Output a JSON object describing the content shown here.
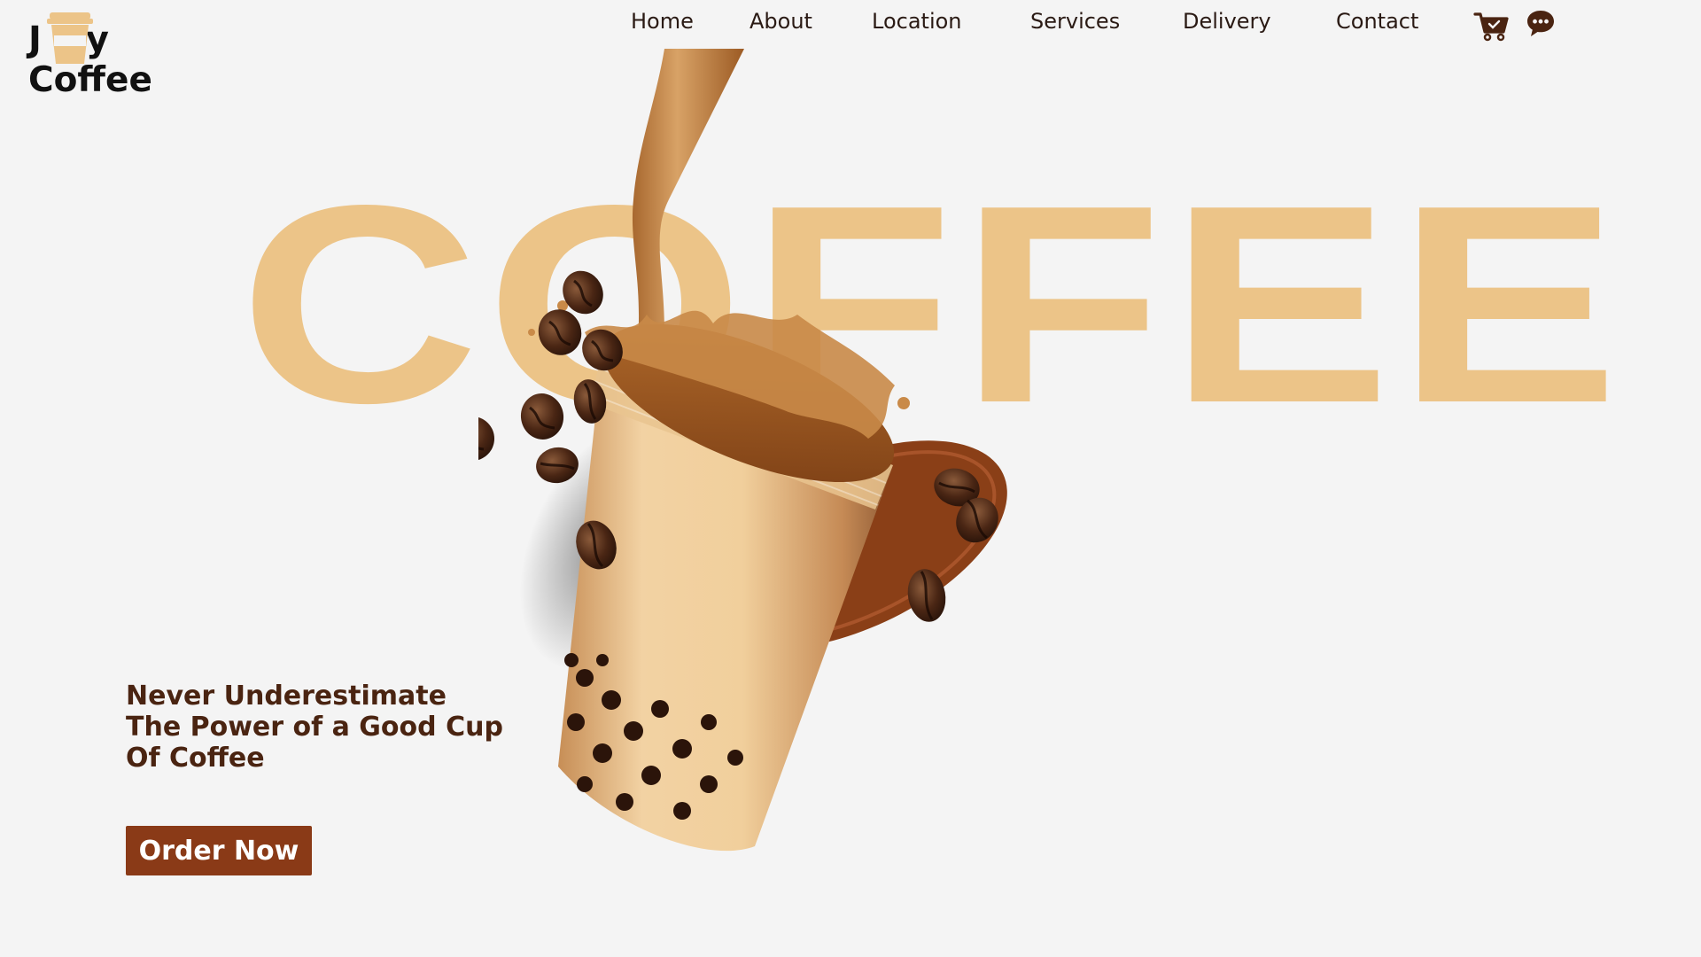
{
  "brand": {
    "logo_line1_left": "J",
    "logo_line1_right": "y",
    "logo_line2": "Coffee",
    "accent_color": "#ecc488",
    "dark_brown": "#4a2411",
    "button_color": "#8a3a17"
  },
  "nav": {
    "items": [
      {
        "label": "Home"
      },
      {
        "label": "About"
      },
      {
        "label": "Location"
      },
      {
        "label": "Services"
      },
      {
        "label": "Delivery"
      },
      {
        "label": "Contact"
      }
    ],
    "icons": [
      "cart-icon",
      "chat-icon"
    ]
  },
  "hero": {
    "word": "COFFEE",
    "tagline_lines": [
      "Never Underestimate",
      "The Power of a Good Cup",
      "Of Coffee"
    ],
    "cta_label": "Order Now"
  }
}
